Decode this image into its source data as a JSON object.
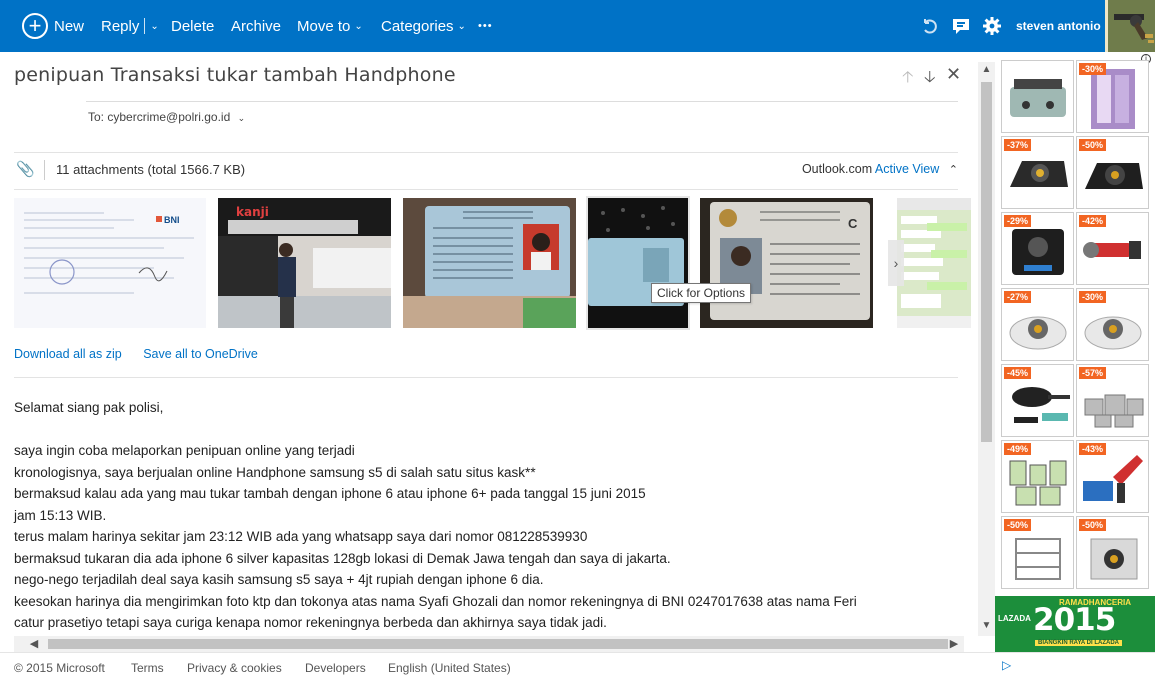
{
  "toolbar": {
    "new_label": "New",
    "reply_label": "Reply",
    "delete_label": "Delete",
    "archive_label": "Archive",
    "moveto_label": "Move to",
    "categories_label": "Categories",
    "more_label": "•••",
    "user_name": "steven antonio"
  },
  "message": {
    "subject": "penipuan Transaksi tukar tambah Handphone",
    "to_label": "To:",
    "to_address": "cybercrime@polri.go.id"
  },
  "attachments": {
    "summary": "11 attachments (total 1566.7 KB)",
    "viewer_label": "Outlook.com",
    "viewer_link": "Active View",
    "download_all": "Download all as zip",
    "save_onedrive": "Save all to OneDrive",
    "tooltip": "Click for Options"
  },
  "body": {
    "lines": [
      "Selamat siang pak polisi,",
      "",
      "saya ingin coba melaporkan penipuan online yang terjadi",
      "kronologisnya, saya berjualan online Handphone samsung s5 di salah satu situs kask**",
      "bermaksud kalau ada yang mau tukar tambah dengan iphone 6 atau iphone 6+ pada tanggal 15 juni  2015",
      "jam 15:13 WIB.",
      "terus malam harinya sekitar jam 23:12 WIB ada yang whatsapp saya dari nomor 081228539930",
      "bermaksud tukaran dia ada iphone 6 silver kapasitas 128gb lokasi di Demak Jawa tengah dan saya di jakarta.",
      "nego-nego terjadilah deal saya kasih samsung s5 saya + 4jt rupiah dengan iphone 6 dia.",
      "keesokan harinya dia mengirimkan foto ktp dan tokonya  atas nama Syafi Ghozali dan nomor rekeningnya di BNI 0247017638 atas nama Feri",
      "catur prasetiyo tetapi saya curiga kenapa nomor rekeningnya berbeda dan akhirnya saya tidak jadi."
    ]
  },
  "footer": {
    "copyright": "© 2015 Microsoft",
    "terms": "Terms",
    "privacy": "Privacy & cookies",
    "developers": "Developers",
    "language": "English (United States)"
  },
  "ads": {
    "badges": [
      "",
      "-30%",
      "-37%",
      "-50%",
      "-29%",
      "-42%",
      "-27%",
      "-30%",
      "-45%",
      "-57%",
      "-49%",
      "-43%",
      "-50%",
      "-50%"
    ],
    "banner_top": "RAMADHANCERIA",
    "banner_brand": "LAZADA",
    "banner_year": "2015",
    "banner_sub": "BIANGKIN RAYA DI LAZADA"
  },
  "colors": {
    "topbar": "#0072c6",
    "link": "#0072c6",
    "badge": "#f26522",
    "banner": "#1c8e3b"
  }
}
